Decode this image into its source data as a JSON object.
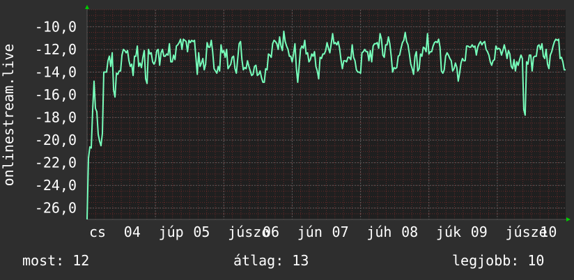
{
  "chart_data": {
    "type": "line",
    "ylabel": "onlinestream.live",
    "y_ticks": [
      "-10,0",
      "-12,0",
      "-14,0",
      "-16,0",
      "-18,0",
      "-20,0",
      "-22,0",
      "-24,0",
      "-26,0"
    ],
    "y_values": [
      -10,
      -12,
      -14,
      -16,
      -18,
      -20,
      -22,
      -24,
      -26
    ],
    "ylim": [
      -27,
      -8.5
    ],
    "x_tick_labels": [
      "cs",
      "04",
      "júp",
      "05",
      "júszo",
      "06",
      "jún",
      "07",
      "júh",
      "08",
      "júk",
      "09",
      "júsze",
      "10",
      "jún"
    ],
    "grid": true,
    "x": [
      0,
      1,
      2,
      3,
      4,
      5,
      6,
      7,
      8,
      9,
      10,
      11,
      12,
      13,
      14,
      15,
      16,
      17,
      18,
      19,
      20,
      21,
      22,
      23,
      24,
      25,
      26,
      27,
      28,
      29,
      30,
      31,
      32,
      33,
      34,
      35,
      36,
      37,
      38,
      39,
      40,
      41,
      42,
      43,
      44,
      45,
      46,
      47,
      48,
      49,
      50,
      51,
      52,
      53,
      54,
      55,
      56,
      57,
      58,
      59,
      60,
      61,
      62,
      63,
      64,
      65,
      66,
      67,
      68,
      69,
      70,
      71,
      72,
      73,
      74,
      75,
      76,
      77,
      78,
      79,
      80,
      81,
      82,
      83,
      84,
      85,
      86,
      87,
      88,
      89,
      90,
      91,
      92,
      93,
      94,
      95,
      96,
      97,
      98,
      99,
      100,
      101,
      102,
      103,
      104,
      105,
      106,
      107,
      108,
      109,
      110,
      111,
      112,
      113,
      114,
      115,
      116,
      117,
      118,
      119,
      120,
      121,
      122,
      123,
      124,
      125,
      126,
      127,
      128,
      129,
      130,
      131,
      132,
      133,
      134,
      135,
      136,
      137,
      138,
      139,
      140,
      141,
      142,
      143,
      144,
      145,
      146,
      147,
      148,
      149,
      150,
      151,
      152,
      153,
      154,
      155,
      156,
      157,
      158,
      159,
      160,
      161,
      162,
      163,
      164,
      165,
      166,
      167,
      168,
      169,
      170,
      171,
      172,
      173,
      174,
      175,
      176,
      177,
      178,
      179,
      180,
      181,
      182,
      183,
      184,
      185,
      186,
      187,
      188,
      189,
      190,
      191,
      192,
      193,
      194,
      195,
      196,
      197,
      198,
      199,
      200,
      201,
      202,
      203,
      204,
      205,
      206,
      207,
      208,
      209,
      210,
      211,
      212,
      213,
      214,
      215,
      216,
      217,
      218,
      219,
      220,
      221,
      222,
      223,
      224,
      225,
      226,
      227,
      228,
      229,
      230,
      231,
      232,
      233,
      234,
      235,
      236,
      237,
      238,
      239,
      240,
      241,
      242,
      243,
      244,
      245,
      246,
      247,
      248,
      249,
      250,
      251,
      252,
      253,
      254,
      255,
      256,
      257,
      258,
      259,
      260,
      261,
      262,
      263,
      264,
      265,
      266,
      267,
      268,
      269,
      270,
      271,
      272,
      273,
      274,
      275,
      276,
      277,
      278,
      279,
      280,
      281,
      282,
      283,
      284,
      285,
      286,
      287,
      288,
      289,
      290,
      291,
      292,
      293,
      294,
      295,
      296,
      297,
      298,
      299,
      300,
      301,
      302,
      303,
      304,
      305,
      306,
      307,
      308,
      309,
      310,
      311,
      312,
      313,
      314,
      315,
      316,
      317,
      318,
      319,
      320,
      321,
      322,
      323,
      324,
      325,
      326,
      327,
      328,
      329,
      330,
      331,
      332,
      333,
      334,
      335,
      336,
      337,
      338,
      339,
      340,
      341,
      342,
      343
    ],
    "values": [
      -27,
      -21.6,
      -20.6,
      -20.7,
      -17.4,
      -14.8,
      -17.2,
      -17.5,
      -19.5,
      -20.1,
      -20.5,
      -19.4,
      -14,
      -14,
      -14,
      -13,
      -12.6,
      -13.5,
      -12.3,
      -15.6,
      -16.2,
      -14.1,
      -14.2,
      -13.9,
      -13.9,
      -12.5,
      -12,
      -12.1,
      -12.3,
      -12.1,
      -13,
      -13.5,
      -13.3,
      -14.3,
      -12.6,
      -12.6,
      -11.7,
      -13.5,
      -13.2,
      -13.6,
      -12.7,
      -12.1,
      -14.6,
      -15,
      -12,
      -12.4,
      -12.3,
      -13.1,
      -13.3,
      -13,
      -12.1,
      -12,
      -13.4,
      -12.3,
      -12,
      -12.6,
      -12.6,
      -12.4,
      -12.5,
      -11.5,
      -13.1,
      -13.1,
      -12.5,
      -12.9,
      -11.7,
      -11.6,
      -11.4,
      -11.1,
      -12,
      -11.1,
      -11.2,
      -11.3,
      -12.2,
      -11.2,
      -11.4,
      -11.2,
      -11.3,
      -11.2,
      -12.7,
      -14.2,
      -12.3,
      -13.5,
      -13.2,
      -12.8,
      -13.8,
      -13.3,
      -11.4,
      -11.8,
      -11.8,
      -11.2,
      -12.2,
      -13.7,
      -13.9,
      -14.1,
      -13.5,
      -13.9,
      -11.6,
      -12.3,
      -12.1,
      -12.7,
      -12,
      -13.7,
      -13.5,
      -13.3,
      -12.7,
      -12.6,
      -13.7,
      -14.1,
      -12.8,
      -11.5,
      -11.3,
      -12.9,
      -13.8,
      -13.6,
      -13.7,
      -13,
      -13.5,
      -13.9,
      -14.3,
      -14.2,
      -13.5,
      -13.4,
      -14.3,
      -14.2,
      -13.9,
      -14.5,
      -14.9,
      -14.9,
      -13.7,
      -13.8,
      -12.4,
      -12.5,
      -12.7,
      -11.5,
      -11.2,
      -11.3,
      -11.5,
      -12,
      -10.9,
      -11.7,
      -12.1,
      -10.4,
      -11.3,
      -11.7,
      -12,
      -12.6,
      -12.6,
      -13.1,
      -12.4,
      -11.5,
      -13.6,
      -14.9,
      -13.5,
      -12,
      -11.7,
      -11.9,
      -11.2,
      -12.4,
      -12.3,
      -13.1,
      -12.9,
      -12.4,
      -12.6,
      -12.2,
      -13.5,
      -13.9,
      -14.6,
      -12.7,
      -12.8,
      -12.4,
      -12.4,
      -12.1,
      -11.4,
      -11.9,
      -12.3,
      -11.5,
      -10.6,
      -11.5,
      -11.4,
      -11.6,
      -11.3,
      -11.9,
      -12.9,
      -13.7,
      -13,
      -13,
      -13.1,
      -12.7,
      -12.7,
      -12.9,
      -11.6,
      -12.7,
      -13,
      -13.8,
      -14,
      -14,
      -14.1,
      -12.3,
      -12.2,
      -12,
      -12.2,
      -12.2,
      -13,
      -12.1,
      -13.1,
      -11.7,
      -11.5,
      -11.5,
      -11.4,
      -11.9,
      -10.6,
      -11.1,
      -12.5,
      -12.7,
      -11.6,
      -11.6,
      -10.9,
      -11.5,
      -12.6,
      -14,
      -13.6,
      -13.7,
      -13.6,
      -12.6,
      -12.5,
      -11.9,
      -11.4,
      -11.2,
      -10.5,
      -11.3,
      -11.6,
      -12.4,
      -13.3,
      -13.7,
      -14.2,
      -12.6,
      -12.2,
      -13.9,
      -13.7,
      -12.4,
      -12.6,
      -11.8,
      -11.9,
      -12.2,
      -10.6,
      -12.4,
      -12.2,
      -12.2,
      -11.7,
      -11.4,
      -11.3,
      -11.4,
      -11.1,
      -11.8,
      -13.9,
      -14.1,
      -13.8,
      -12.6,
      -12.3,
      -12.5,
      -12.8,
      -13,
      -13.9,
      -13.7,
      -13.2,
      -13.6,
      -14.8,
      -14.1,
      -13.2,
      -12.8,
      -13,
      -13,
      -11.7,
      -11.7,
      -11.8,
      -11.8,
      -11.6,
      -11.8,
      -11.7,
      -12.5,
      -11.8,
      -11.5,
      -11.3,
      -11.6,
      -11.4,
      -11.3,
      -12,
      -12.2,
      -12.5,
      -13.1,
      -13.4,
      -13,
      -12.9,
      -11.7,
      -12,
      -11.9,
      -12,
      -12.5,
      -12.1,
      -11.6,
      -12.1,
      -12.8,
      -12.1,
      -12.4,
      -13.5,
      -13.7,
      -12.9,
      -13.9,
      -13.1,
      -13.4,
      -12.9,
      -12.5,
      -12.8,
      -17.3,
      -17.8,
      -13.1,
      -13.3,
      -12.5,
      -12.5,
      -13.9,
      -12.7,
      -12.6,
      -12.6,
      -11.7,
      -11.6,
      -12,
      -11.5,
      -12.6,
      -12.8,
      -12,
      -13.3,
      -13.7,
      -12.5,
      -12.2,
      -11.7,
      -11.3,
      -11.1,
      -11.2,
      -11.1,
      -12.8,
      -12.7,
      -13.1,
      -13.8,
      -13.8,
      -14,
      -13.8,
      -13.7,
      -14,
      -13.7,
      -13.5,
      -12.4
    ],
    "series": [
      {
        "color": "#77ffbb"
      }
    ]
  },
  "legend": {
    "now": "most: 12",
    "avg": "átlag: 13",
    "best": "legjobb: 10"
  },
  "colors": {
    "background": "#2e2e2e",
    "plot": "#1f1f1f",
    "grid_major": "#5a5a5a",
    "grid_minor": "#6a2a2a",
    "line": "#77ffbb",
    "axis_arrow": "#00cc00",
    "text": "#ffffff"
  }
}
